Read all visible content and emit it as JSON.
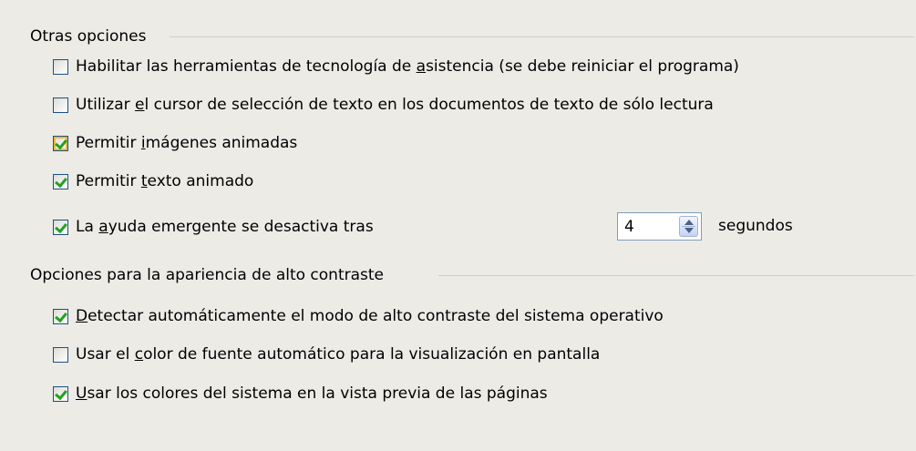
{
  "sections": [
    {
      "title": "Otras opciones",
      "options": [
        {
          "pre": "Habilitar las herramientas de tecnología de ",
          "key": "a",
          "post": "sistencia (se debe reiniciar el programa)",
          "checked": false
        },
        {
          "pre": "Utilizar ",
          "key": "e",
          "post": "l cursor de selección de texto en los documentos de texto de sólo lectura",
          "checked": false
        },
        {
          "pre": "Permitir ",
          "key": "i",
          "post": "mágenes animadas",
          "checked": true
        },
        {
          "pre": "Permitir ",
          "key": "t",
          "post": "exto animado",
          "checked": true
        },
        {
          "pre": "La ",
          "key": "a",
          "post": "yuda emergente se desactiva tras",
          "checked": true
        }
      ]
    },
    {
      "title": "Opciones para la apariencia de alto contraste",
      "options": [
        {
          "pre": "",
          "key": "D",
          "post": "etectar automáticamente el modo de alto contraste del sistema operativo",
          "checked": true
        },
        {
          "pre": "Usar el ",
          "key": "c",
          "post": "olor de fuente automático para la visualización en pantalla",
          "checked": false
        },
        {
          "pre": "",
          "key": "U",
          "post": "sar los colores del sistema en la vista previa de las páginas",
          "checked": true
        }
      ]
    }
  ],
  "tooltip_timeout": {
    "value": "4",
    "unit": "segundos"
  },
  "colors": {
    "background": "#ecebe6",
    "checkbox_border": "#1c5180",
    "checkmark": "#21a121",
    "hover_highlight": "#f8b636",
    "spin_border": "#7f9db9"
  }
}
